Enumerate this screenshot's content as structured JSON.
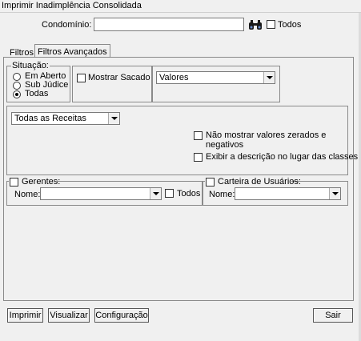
{
  "window": {
    "title": "Imprimir Inadimplência Consolidada"
  },
  "header": {
    "condominio_label": "Condomínio:",
    "condominio_value": "",
    "search_icon": "binoculars-icon",
    "todos_label": "Todos",
    "todos_checked": false
  },
  "tabs": [
    {
      "label": "Filtros",
      "active": false
    },
    {
      "label": "Filtros Avançados",
      "active": true
    }
  ],
  "situacao": {
    "legend": "Situação:",
    "options": [
      {
        "label": "Em Aberto",
        "selected": false
      },
      {
        "label": "Sub Júdice",
        "selected": false
      },
      {
        "label": "Todas",
        "selected": true
      }
    ]
  },
  "mostrar_sacado": {
    "label": "Mostrar Sacado",
    "checked": false
  },
  "valores_select": {
    "value": "Valores"
  },
  "receitas_select": {
    "value": "Todas as Receitas"
  },
  "options": {
    "nao_mostrar_zerados": {
      "label": "Não mostrar valores zerados e negativos",
      "checked": false
    },
    "exibir_descricao": {
      "label": "Exibir a descrição no lugar das classes.",
      "checked": false
    }
  },
  "gerentes": {
    "legend": "Gerentes:",
    "checked": false,
    "nome_label": "Nome:",
    "nome_value": "",
    "todos_label": "Todos",
    "todos_checked": false
  },
  "carteira": {
    "legend": "Carteira de Usuários:",
    "checked": false,
    "nome_label": "Nome:",
    "nome_value": ""
  },
  "footer": {
    "imprimir": "Imprimir",
    "visualizar": "Visualizar",
    "configuracao": "Configuração",
    "sair": "Sair"
  }
}
